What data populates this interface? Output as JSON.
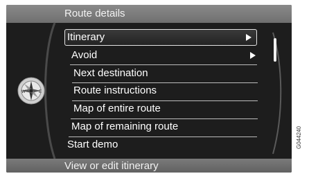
{
  "header": {
    "title": "Route details"
  },
  "menu": {
    "items": [
      {
        "label": "Itinerary",
        "has_submenu": true,
        "selected": true
      },
      {
        "label": "Avoid",
        "has_submenu": true,
        "selected": false
      },
      {
        "label": "Next destination",
        "has_submenu": false,
        "selected": false
      },
      {
        "label": "Route instructions",
        "has_submenu": false,
        "selected": false
      },
      {
        "label": "Map of entire route",
        "has_submenu": false,
        "selected": false
      },
      {
        "label": "Map of remaining route",
        "has_submenu": false,
        "selected": false
      },
      {
        "label": "Start demo",
        "has_submenu": false,
        "selected": false
      }
    ]
  },
  "footer": {
    "hint": "View or edit itinerary"
  },
  "figure_code": "G044240",
  "icons": {
    "compass": "compass-icon",
    "submenu": "triangle-right-icon"
  },
  "colors": {
    "screen_bg": "#1d1d1d",
    "bar_bg": "#7d7d7d",
    "text": "#ffffff"
  }
}
